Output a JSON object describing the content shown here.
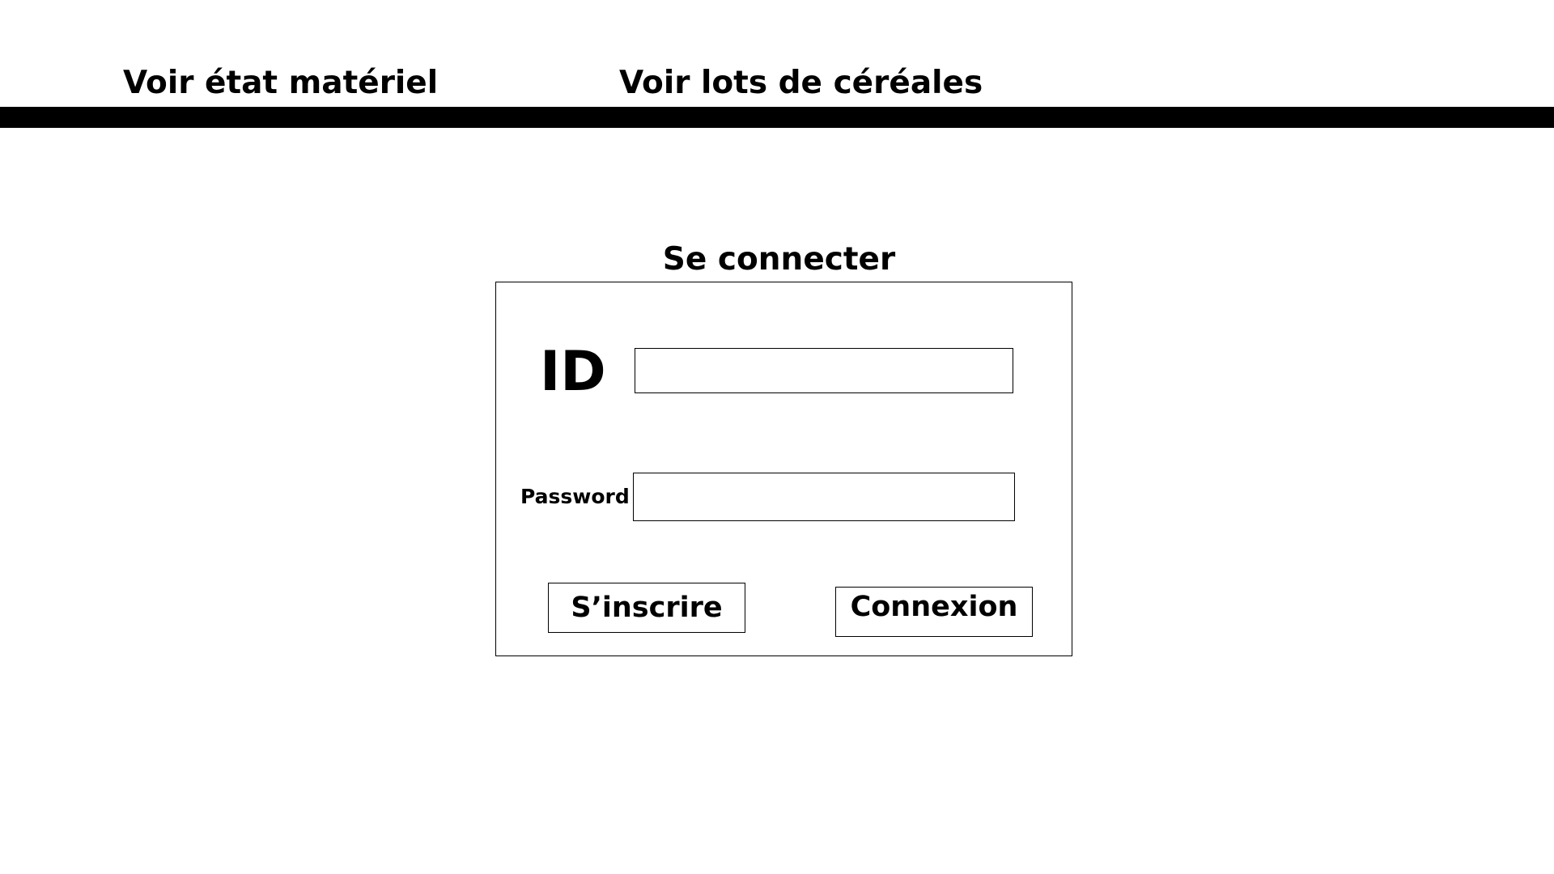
{
  "nav": {
    "items": [
      {
        "label": "Voir état matériel"
      },
      {
        "label": "Voir lots de céréales"
      }
    ]
  },
  "login": {
    "title": "Se connecter",
    "id_label": "ID",
    "id_value": "",
    "password_label": "Password",
    "password_value": "",
    "signup_label": "S’inscrire",
    "connect_label": "Connexion"
  }
}
